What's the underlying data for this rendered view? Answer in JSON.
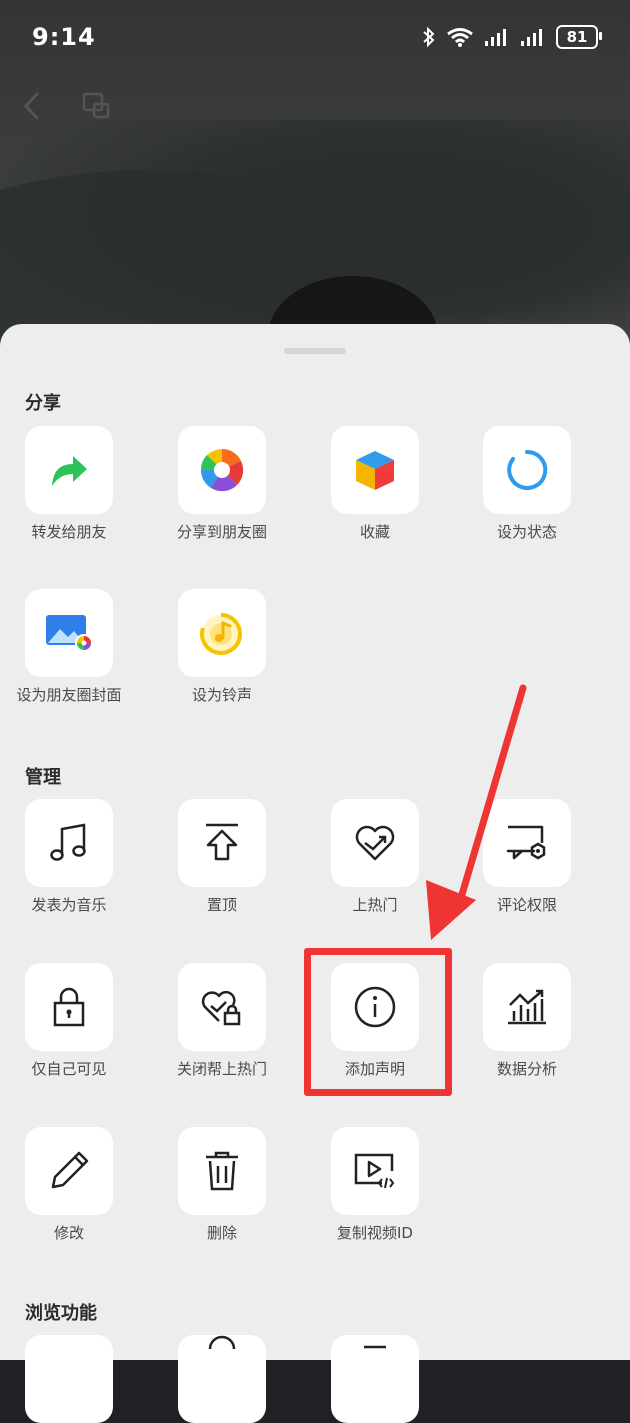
{
  "status_bar": {
    "time": "9:14",
    "battery": "81"
  },
  "sections": {
    "share": {
      "title": "分享",
      "items": [
        {
          "label": "转发给朋友",
          "icon": "forward-arrow-icon"
        },
        {
          "label": "分享到朋友圈",
          "icon": "moments-aperture-icon"
        },
        {
          "label": "收藏",
          "icon": "favorites-cube-icon"
        },
        {
          "label": "设为状态",
          "icon": "status-ring-icon"
        },
        {
          "label": "设为朋友圈封面",
          "icon": "moments-cover-icon"
        },
        {
          "label": "设为铃声",
          "icon": "ringtone-icon"
        }
      ]
    },
    "manage": {
      "title": "管理",
      "items": [
        {
          "label": "发表为音乐",
          "icon": "music-note-icon"
        },
        {
          "label": "置顶",
          "icon": "pin-top-icon"
        },
        {
          "label": "上热门",
          "icon": "trending-heart-icon"
        },
        {
          "label": "评论权限",
          "icon": "comment-settings-icon"
        },
        {
          "label": "仅自己可见",
          "icon": "lock-icon"
        },
        {
          "label": "关闭帮上热门",
          "icon": "trending-lock-icon"
        },
        {
          "label": "添加声明",
          "icon": "info-icon"
        },
        {
          "label": "数据分析",
          "icon": "chart-trend-icon"
        },
        {
          "label": "修改",
          "icon": "pencil-icon"
        },
        {
          "label": "删除",
          "icon": "trash-icon"
        },
        {
          "label": "复制视频ID",
          "icon": "video-id-icon"
        }
      ]
    },
    "browse": {
      "title": "浏览功能"
    }
  },
  "colors": {
    "highlight": "#ef3434",
    "accent_green": "#2fc25b",
    "accent_blue": "#2f9bea"
  }
}
